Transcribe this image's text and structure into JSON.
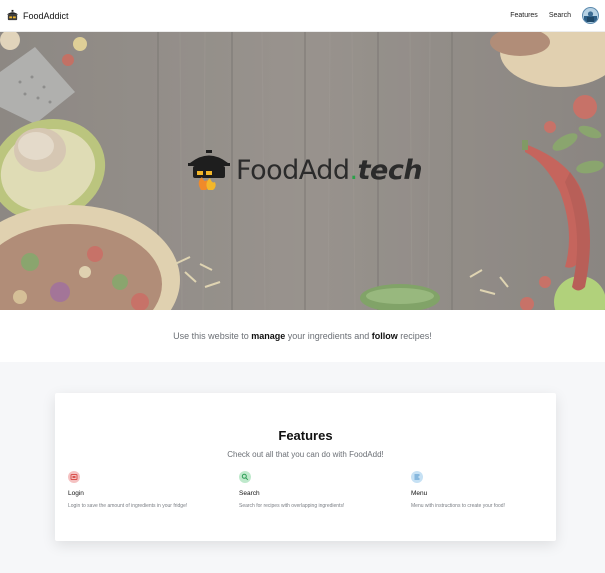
{
  "nav": {
    "brand": "FoodAddict",
    "links": [
      "Features",
      "Search"
    ]
  },
  "hero": {
    "logo_main": "FoodAdd",
    "logo_dot": ".",
    "logo_tld": "tech"
  },
  "tagline": {
    "pre": "Use this website to ",
    "strong1": "manage",
    "mid": " your ingredients and ",
    "strong2": "follow",
    "post": " recipes!"
  },
  "features": {
    "title": "Features",
    "subtitle": "Check out all that you can do with FoodAdd!",
    "items": [
      {
        "icon": "fridge-icon",
        "title": "Login",
        "desc": "Login to save the amount of ingredients in your fridge!",
        "color": "#f5b5b5",
        "accent": "#d9534f"
      },
      {
        "icon": "search-icon",
        "title": "Search",
        "desc": "Search for recipes with overlapping ingredients!",
        "color": "#b7e7c4",
        "accent": "#2f9e57"
      },
      {
        "icon": "list-icon",
        "title": "Menu",
        "desc": "Menu with instructions to create your food!",
        "color": "#bcdcf2",
        "accent": "#3a85c4"
      }
    ]
  }
}
